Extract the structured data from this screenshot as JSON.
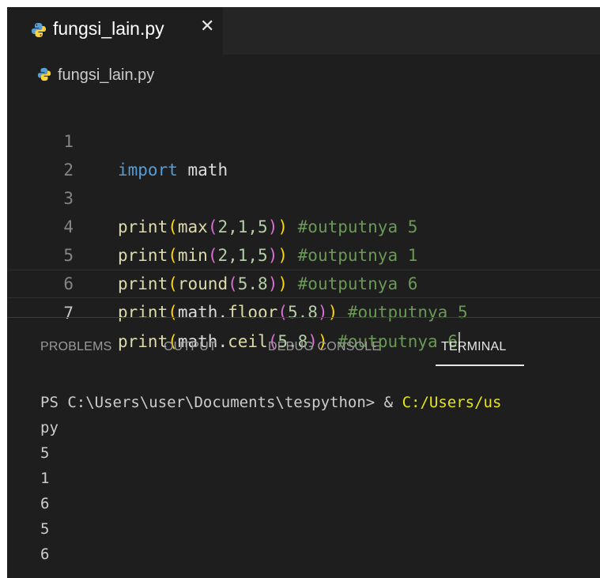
{
  "tab": {
    "label": "fungsi_lain.py",
    "close": "✕"
  },
  "breadcrumb": {
    "label": "fungsi_lain.py"
  },
  "editor": {
    "line_numbers": [
      "1",
      "2",
      "3",
      "4",
      "5",
      "6",
      "7"
    ],
    "line1": {
      "kw": "import",
      "mod": "math"
    },
    "line3": {
      "fn": "print",
      "p1": "(",
      "fn2": "max",
      "p2": "(",
      "args": "2,1,5",
      "p2c": ")",
      "p1c": ")",
      "comment": "#outputnya 5"
    },
    "line4": {
      "fn": "print",
      "p1": "(",
      "fn2": "min",
      "p2": "(",
      "args": "2,1,5",
      "p2c": ")",
      "p1c": ")",
      "comment": "#outputnya 1"
    },
    "line5": {
      "fn": "print",
      "p1": "(",
      "fn2": "round",
      "p2": "(",
      "args": "5.8",
      "p2c": ")",
      "p1c": ")",
      "comment": "#outputnya 6"
    },
    "line6": {
      "fn": "print",
      "p1": "(",
      "mod": "math",
      "dot": ".",
      "fn2": "floor",
      "p2": "(",
      "args": "5.8",
      "p2c": ")",
      "p1c": ")",
      "comment": "#outputnya 5"
    },
    "line7": {
      "fn": "print",
      "p1": "(",
      "mod": "math",
      "dot": ".",
      "fn2": "ceil",
      "p2": "(",
      "args": "5.8",
      "p2c": ")",
      "p1c": ")",
      "comment": "#outputnya 6"
    }
  },
  "panel": {
    "tabs": [
      "PROBLEMS",
      "OUTPUT",
      "DEBUG CONSOLE",
      "TERMINAL"
    ],
    "active_tab": "TERMINAL"
  },
  "terminal": {
    "prompt": "PS C:\\Users\\user\\Documents\\tespython> & ",
    "command_path": "C:/Users/us",
    "wrap": "py",
    "outputs": [
      "5",
      "1",
      "6",
      "5",
      "6"
    ]
  },
  "colors": {
    "editor_bg": "#1e1e1e",
    "keyword": "#569cd6",
    "function": "#dcdcaa",
    "number": "#b5cea8",
    "comment": "#6a9955",
    "bracket_level1": "#ffd700",
    "bracket_level2": "#da70d6",
    "terminal_path": "#e5e510"
  },
  "icons": {
    "file": "python-icon",
    "close": "close-icon"
  }
}
